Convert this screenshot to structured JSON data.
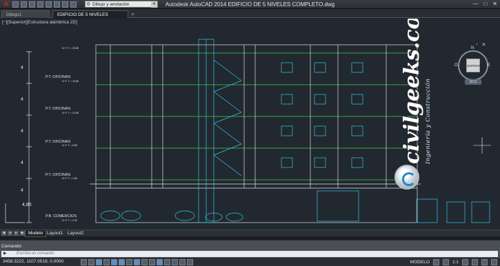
{
  "titlebar": {
    "app_logo": "A",
    "app_logo_icon": "autocad-logo-icon",
    "workspace": "Dibujo y anotación",
    "title": "Autodesk AutoCAD 2014    EDIFICIO DE 5 NIVELES COMPLETO.dwg"
  },
  "tabs": [
    {
      "label": "Dibujo1"
    },
    {
      "label": "EDIFICIO DE 5 NIVELES COMPLETO*"
    }
  ],
  "viewport": {
    "label": "[−][Superior][Estructura alámbrica 2D]"
  },
  "viewcube": {
    "face": "SUPERIOR",
    "north": "N",
    "south": "S",
    "east": "E",
    "west": "O",
    "wcs": "SCU"
  },
  "drawing": {
    "dims": [
      "4",
      "4",
      "4",
      "4",
      "4",
      "4,85"
    ],
    "level_labels": [
      "P.T. OFICINAS",
      "P.T. OFICINAS",
      "P.T. OFICINAS",
      "P.T. OFICINAS",
      "P.B. COMERCIOS"
    ],
    "npt_tags": [
      "N. P. T. = 20.85",
      "N. P. T. = 16.85",
      "N. P. T. = 12.85",
      "N. P. T. = 8.85",
      "N. P. T. = 4.85",
      "N. P. T. = 0.00"
    ],
    "colors": {
      "cyan": "#35c8e8",
      "white": "#e6e6e6",
      "green": "#46d046",
      "accent": "#2a9fd6"
    }
  },
  "watermark": {
    "main": "civilgeeks.com",
    "sub": "Ingeniería y Construcción"
  },
  "layout_tabs": [
    {
      "label": "Modelo",
      "active": true
    },
    {
      "label": "Layout1",
      "active": false
    },
    {
      "label": "Layout2",
      "active": false
    }
  ],
  "command": {
    "history": "Comando:",
    "placeholder": "Escriba un comando"
  },
  "status": {
    "coords": "3458.3222, 1107.0519, 0.0000",
    "model_label": "MODELO",
    "scale": "1:1"
  }
}
